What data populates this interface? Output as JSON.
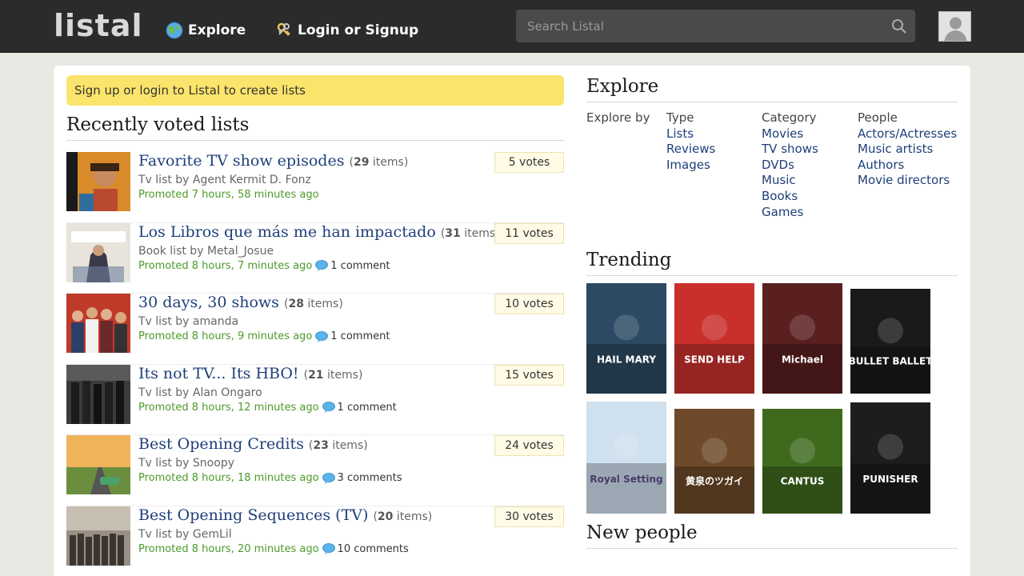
{
  "header": {
    "logo": "listal",
    "nav": [
      {
        "label": "Explore",
        "icon": "globe-icon"
      },
      {
        "label": "Login or Signup",
        "icon": "keys-icon"
      }
    ],
    "search": {
      "placeholder": "Search Listal"
    }
  },
  "notice": {
    "prefix": "Sign up or ",
    "link": "login",
    "suffix": " to Listal to create lists"
  },
  "recent": {
    "heading": "Recently voted lists",
    "items": [
      {
        "title": "Favorite TV show episodes",
        "count": "29",
        "items_word": "items",
        "by": "Tv list by ",
        "author": "Agent Kermit D. Fonz",
        "promoted": "Promoted 7 hours, 58 minutes ago",
        "comments": "",
        "votes": "5 votes",
        "thumb": "magnum"
      },
      {
        "title": "Los Libros que más me han impactado",
        "count": "31",
        "items_word": "items",
        "by": "Book list by ",
        "author": "Metal_Josue",
        "promoted": "Promoted 8 hours, 7 minutes ago",
        "comments": "1 comment",
        "votes": "11 votes",
        "thumb": "miserables"
      },
      {
        "title": "30 days, 30 shows",
        "count": "28",
        "items_word": "items",
        "by": "Tv list by ",
        "author": "amanda",
        "promoted": "Promoted 8 hours, 9 minutes ago",
        "comments": "1 comment",
        "votes": "10 votes",
        "thumb": "cast"
      },
      {
        "title": "Its not TV... Its HBO!",
        "count": "21",
        "items_word": "items",
        "by": "Tv list by ",
        "author": "Alan Ongaro",
        "promoted": "Promoted 8 hours, 12 minutes ago",
        "comments": "1 comment",
        "votes": "15 votes",
        "thumb": "hbo"
      },
      {
        "title": "Best Opening Credits",
        "count": "23",
        "items_word": "items",
        "by": "Tv list by ",
        "author": "Snoopy",
        "promoted": "Promoted 8 hours, 18 minutes ago",
        "comments": "3 comments",
        "votes": "24 votes",
        "thumb": "road"
      },
      {
        "title": "Best Opening Sequences (TV)",
        "count": "20",
        "items_word": "items",
        "by": "Tv list by ",
        "author": "GemLil",
        "promoted": "Promoted 8 hours, 20 minutes ago",
        "comments": "10 comments",
        "votes": "30 votes",
        "thumb": "soldiers"
      }
    ]
  },
  "explore": {
    "heading": "Explore",
    "label": "Explore by",
    "columns": [
      {
        "header": "Type",
        "links": [
          "Lists",
          "Reviews",
          "Images"
        ]
      },
      {
        "header": "Category",
        "links": [
          "Movies",
          "TV shows",
          "DVDs",
          "Music",
          "Books",
          "Games"
        ]
      },
      {
        "header": "People",
        "links": [
          "Actors/Actresses",
          "Music artists",
          "Authors",
          "Movie directors"
        ]
      }
    ]
  },
  "trending": {
    "heading": "Trending",
    "posters": [
      {
        "text": "HAIL MARY",
        "bg": "#2c4a63"
      },
      {
        "text": "SEND HELP",
        "bg": "#c9302c"
      },
      {
        "text": "Michael",
        "bg": "#5a1f1f"
      },
      {
        "text": "BULLET BALLET",
        "bg": "#1a1a1a"
      },
      {
        "text": "Royal Setting",
        "bg": "#cfe0ef"
      },
      {
        "text": "黄泉のツガイ",
        "bg": "#6e4a2a"
      },
      {
        "text": "CANTUS",
        "bg": "#3f6a1e"
      },
      {
        "text": "PUNISHER",
        "bg": "#1d1d1d"
      }
    ]
  },
  "new_people": {
    "heading": "New people"
  },
  "colors": {
    "header_bg": "#2b2b2b",
    "link": "#1e3f7a",
    "promoted": "#4c9a2a",
    "notice": "#fbe46b"
  }
}
